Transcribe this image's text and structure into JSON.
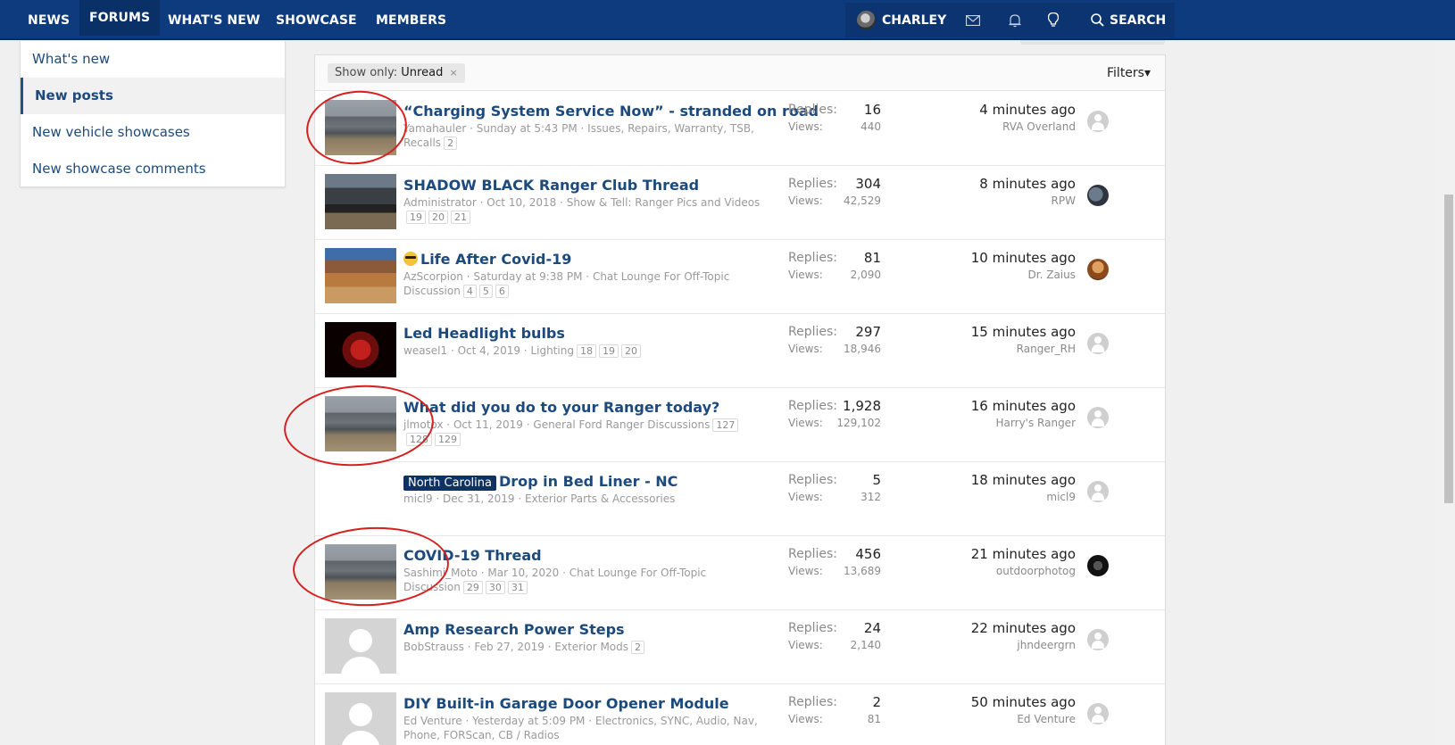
{
  "nav": {
    "items": [
      "NEWS",
      "FORUMS",
      "WHAT'S NEW",
      "SHOWCASE",
      "MEMBERS"
    ],
    "active": "FORUMS",
    "user": "CHARLEY",
    "search": "SEARCH",
    "icons": [
      "envelope-icon",
      "bell-icon",
      "lightbulb-icon",
      "search-icon"
    ]
  },
  "sidebar": {
    "items": [
      {
        "label": "What's new"
      },
      {
        "label": "New posts",
        "active": true
      },
      {
        "label": "New vehicle showcases"
      },
      {
        "label": "New showcase comments"
      }
    ]
  },
  "filterbar": {
    "chip_label": "Show only:",
    "chip_value": "Unread",
    "chip_close": "×",
    "filters": "Filters",
    "filters_caret": "▾"
  },
  "stat_labels": {
    "replies": "Replies:",
    "views": "Views:"
  },
  "threads": [
    {
      "prefix": "",
      "title": "“Charging System Service Now” - stranded on road",
      "author": "Yamahauler",
      "date": "Sunday at 5:43 PM",
      "forum": "Issues, Repairs, Warranty, TSB, Recalls",
      "pages": [
        "2"
      ],
      "replies": "16",
      "views": "440",
      "last_time": "4 minutes ago",
      "last_user": "RVA Overland"
    },
    {
      "prefix": "",
      "title": "SHADOW BLACK Ranger Club Thread",
      "author": "Administrator",
      "date": "Oct 10, 2018",
      "forum": "Show & Tell: Ranger Pics and Videos",
      "pages": [
        "19",
        "20",
        "21"
      ],
      "replies": "304",
      "views": "42,529",
      "last_time": "8 minutes ago",
      "last_user": "RPW"
    },
    {
      "prefix": "",
      "title": "Life After Covid-19",
      "author": "AzScorpion",
      "date": "Saturday at 9:38 PM",
      "forum": "Chat Lounge For Off-Topic Discussion",
      "pages": [
        "4",
        "5",
        "6"
      ],
      "replies": "81",
      "views": "2,090",
      "last_time": "10 minutes ago",
      "last_user": "Dr. Zaius"
    },
    {
      "prefix": "",
      "title": "Led Headlight bulbs",
      "author": "weasel1",
      "date": "Oct 4, 2019",
      "forum": "Lighting",
      "pages": [
        "18",
        "19",
        "20"
      ],
      "replies": "297",
      "views": "18,946",
      "last_time": "15 minutes ago",
      "last_user": "Ranger_RH"
    },
    {
      "prefix": "",
      "title": "What did you do to your Ranger today?",
      "author": "jlmotox",
      "date": "Oct 11, 2019",
      "forum": "General Ford Ranger Discussions",
      "pages": [
        "127",
        "128",
        "129"
      ],
      "replies": "1,928",
      "views": "129,102",
      "last_time": "16 minutes ago",
      "last_user": "Harry's Ranger"
    },
    {
      "prefix": "North Carolina",
      "title": "Drop in Bed Liner - NC",
      "author": "micl9",
      "date": "Dec 31, 2019",
      "forum": "Exterior Parts & Accessories",
      "pages": [],
      "replies": "5",
      "views": "312",
      "last_time": "18 minutes ago",
      "last_user": "micl9"
    },
    {
      "prefix": "",
      "title": "COVID-19 Thread",
      "author": "Sashimi_Moto",
      "date": "Mar 10, 2020",
      "forum": "Chat Lounge For Off-Topic Discussion",
      "pages": [
        "29",
        "30",
        "31"
      ],
      "replies": "456",
      "views": "13,689",
      "last_time": "21 minutes ago",
      "last_user": "outdoorphotog"
    },
    {
      "prefix": "",
      "title": "Amp Research Power Steps",
      "author": "BobStrauss",
      "date": "Feb 27, 2019",
      "forum": "Exterior Mods",
      "pages": [
        "2"
      ],
      "replies": "24",
      "views": "2,140",
      "last_time": "22 minutes ago",
      "last_user": "jhndeergrn"
    },
    {
      "prefix": "",
      "title": "DIY Built-in Garage Door Opener Module",
      "author": "Ed Venture",
      "date": "Yesterday at 5:09 PM",
      "forum": "Electronics, SYNC, Audio, Nav, Phone, FORScan, CB / Radios",
      "pages": [],
      "replies": "2",
      "views": "81",
      "last_time": "50 minutes ago",
      "last_user": "Ed Venture"
    }
  ]
}
